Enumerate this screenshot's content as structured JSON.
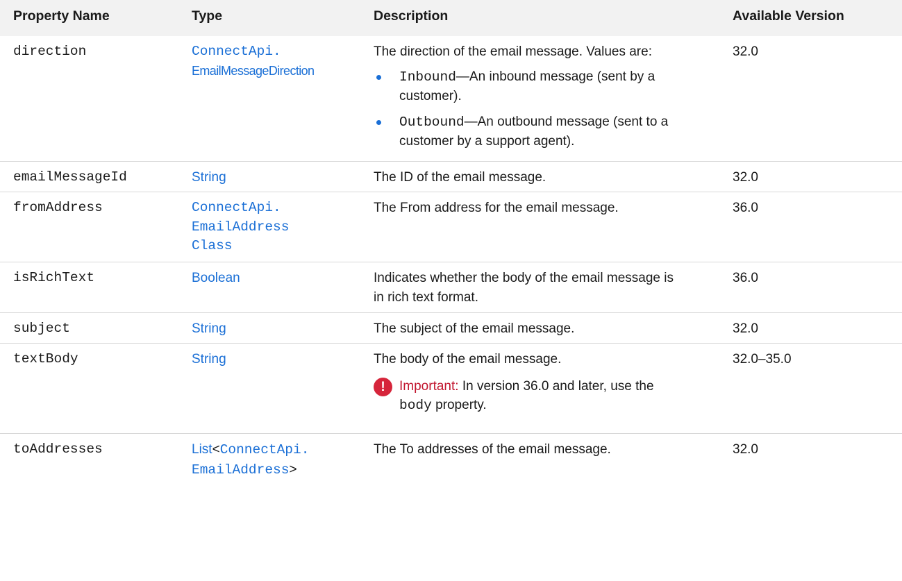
{
  "headers": {
    "property_name": "Property Name",
    "type": "Type",
    "description": "Description",
    "available_version": "Available Version"
  },
  "rows": {
    "direction": {
      "name": "direction",
      "type_1": "ConnectApi.",
      "type_2": "EmailMessageDirection",
      "desc": "The direction of the email message. Values are:",
      "bullet_1_code": "Inbound",
      "bullet_1_text_a": "—An inbound message (sent by a",
      "bullet_1_text_b": "customer).",
      "bullet_2_code": "Outbound",
      "bullet_2_text_a": "—An outbound message (sent to a",
      "bullet_2_text_b": "customer by a support agent).",
      "version": "32.0"
    },
    "emailMessageId": {
      "name": "emailMessageId",
      "type": "String",
      "desc": "The ID of the email message.",
      "version": "32.0"
    },
    "fromAddress": {
      "name": "fromAddress",
      "type_1": "ConnectApi.",
      "type_2": "EmailAddress",
      "type_3": "Class",
      "desc": "The From address for the email message.",
      "version": "36.0"
    },
    "isRichText": {
      "name": "isRichText",
      "type": "Boolean",
      "desc_1": "Indicates whether the body of the email message is",
      "desc_2": "in rich text format.",
      "version": "36.0"
    },
    "subject": {
      "name": "subject",
      "type": "String",
      "desc": "The subject of the email message.",
      "version": "32.0"
    },
    "textBody": {
      "name": "textBody",
      "type": "String",
      "desc": "The body of the email message.",
      "important_label": "Important:",
      "important_text": "In version 36.0 and later, use the",
      "important_code": "body",
      "important_tail": "property.",
      "version": "32.0–35.0"
    },
    "toAddresses": {
      "name": "toAddresses",
      "type_list": "List",
      "type_lt": "<",
      "type_1": "ConnectApi.",
      "type_2": "EmailAddress",
      "type_gt": ">",
      "desc": "The To addresses of the email message.",
      "version": "32.0"
    }
  },
  "icons": {
    "important": "exclamation-circle-icon"
  },
  "colors": {
    "link": "#1a6fd6",
    "bullet": "#1a6fd6",
    "important": "#d6253b",
    "header_bg": "#f2f2f2"
  }
}
